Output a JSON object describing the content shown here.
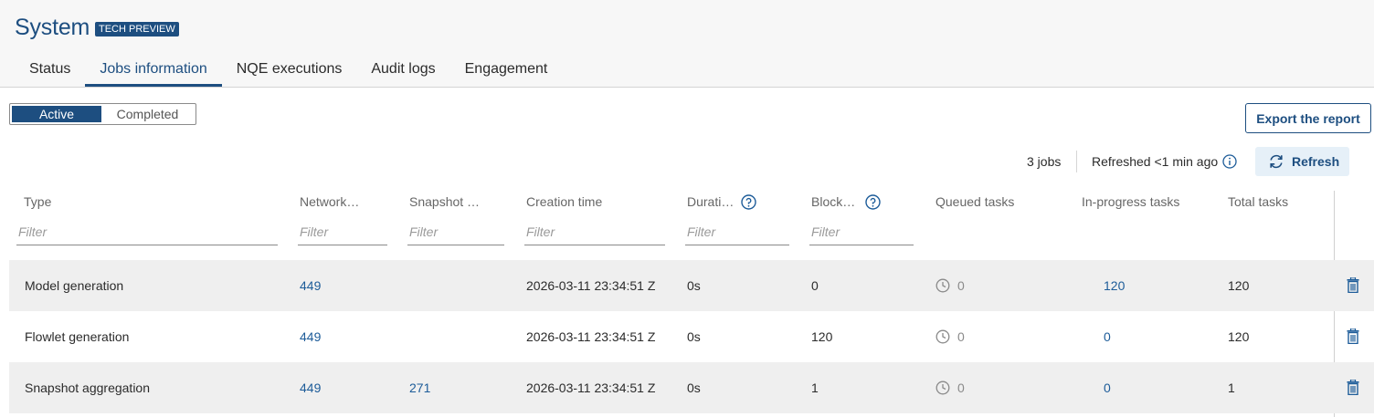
{
  "header": {
    "title": "System",
    "badge": "TECH PREVIEW",
    "tabs": [
      {
        "label": "Status"
      },
      {
        "label": "Jobs information"
      },
      {
        "label": "NQE executions"
      },
      {
        "label": "Audit logs"
      },
      {
        "label": "Engagement"
      }
    ],
    "active_tab": "Jobs information"
  },
  "toggle": {
    "active": "Active",
    "completed": "Completed",
    "selected": "Active"
  },
  "toolbar": {
    "export_label": "Export the report",
    "jobs_count": "3 jobs",
    "refreshed": "Refreshed <1 min ago",
    "refresh_label": "Refresh"
  },
  "table": {
    "columns": [
      {
        "label": "Type"
      },
      {
        "label": "Network…"
      },
      {
        "label": "Snapshot …"
      },
      {
        "label": "Creation time"
      },
      {
        "label": "Durati…"
      },
      {
        "label": "Block…"
      },
      {
        "label": "Queued tasks"
      },
      {
        "label": "In-progress tasks"
      },
      {
        "label": "Total tasks"
      }
    ],
    "filter_placeholder": "Filter",
    "rows": [
      {
        "type": "Model generation",
        "network": "449",
        "snapshot": "",
        "created": "2026-03-11  23:34:51 Z",
        "duration": "0s",
        "blocked": "0",
        "queued": "0",
        "in_progress": "120",
        "total": "120"
      },
      {
        "type": "Flowlet generation",
        "network": "449",
        "snapshot": "",
        "created": "2026-03-11  23:34:51 Z",
        "duration": "0s",
        "blocked": "120",
        "queued": "0",
        "in_progress": "0",
        "total": "120"
      },
      {
        "type": "Snapshot aggregation",
        "network": "449",
        "snapshot": "271",
        "created": "2026-03-11  23:34:51 Z",
        "duration": "0s",
        "blocked": "1",
        "queued": "0",
        "in_progress": "0",
        "total": "1"
      }
    ]
  },
  "colors": {
    "primary": "#1d4e80",
    "link": "#1d5c99",
    "refresh_bg": "#e6f0f8",
    "row_alt": "#efefef"
  },
  "icons": {
    "help": "question-circle-icon",
    "info": "info-circle-icon",
    "refresh": "refresh-icon",
    "clock": "clock-icon",
    "delete": "trash-icon"
  }
}
